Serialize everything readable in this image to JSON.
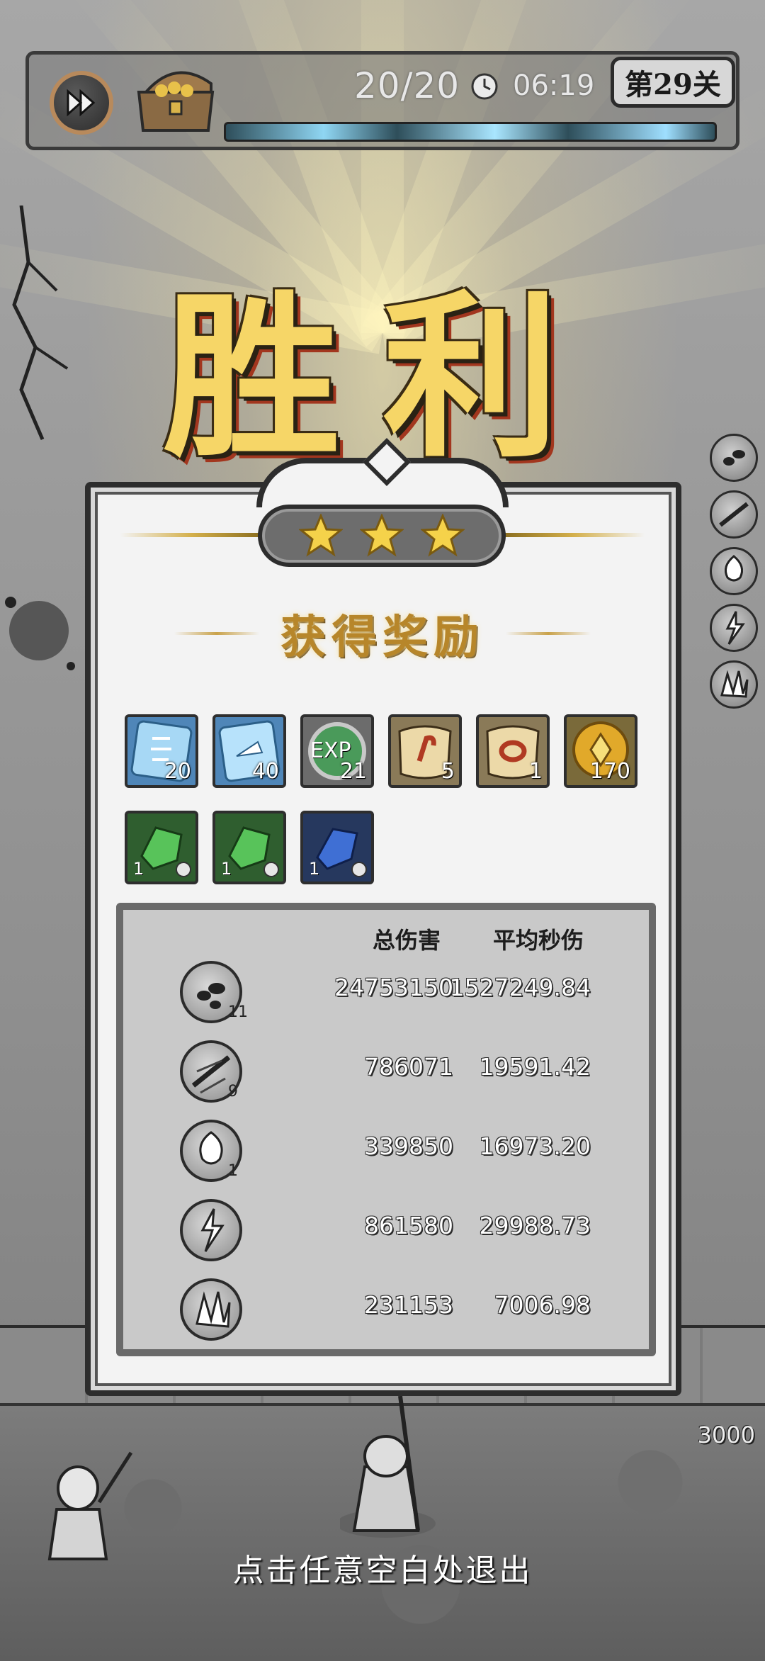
{
  "hud": {
    "wave": "20/20",
    "timer": "06:19",
    "level": "第29关",
    "speed_icon": "fast-forward-icon",
    "chest_icon": "treasure-chest-icon",
    "clock_icon": "clock-icon"
  },
  "result": {
    "title": "胜利",
    "stars_earned": 3,
    "stars_total": 3
  },
  "rewards": {
    "title": "获得奖励",
    "items": [
      {
        "icon": "blue-scroll-gem-icon",
        "count": "20"
      },
      {
        "icon": "blue-card-gem-icon",
        "count": "40"
      },
      {
        "icon": "exp-orb-icon",
        "count": "21",
        "label": "EXP"
      },
      {
        "icon": "scroll-hook-icon",
        "count": "5"
      },
      {
        "icon": "scroll-ring-icon",
        "count": "1"
      },
      {
        "icon": "gold-coin-icon",
        "count": "170"
      },
      {
        "icon": "green-crystal-icon",
        "count": "1"
      },
      {
        "icon": "green-crystal-icon",
        "count": "1"
      },
      {
        "icon": "blue-crystal-icon",
        "count": "1"
      }
    ]
  },
  "stats": {
    "header_total": "总伤害",
    "header_dps": "平均秒伤",
    "rows": [
      {
        "icon": "ink-drops-skill-icon",
        "level": "11",
        "total": "24753150",
        "dps": "1527249.84"
      },
      {
        "icon": "dash-strike-skill-icon",
        "level": "9",
        "total": "786071",
        "dps": "19591.42"
      },
      {
        "icon": "splash-skill-icon",
        "level": "1",
        "total": "339850",
        "dps": "16973.20"
      },
      {
        "icon": "lightning-skill-icon",
        "level": "",
        "total": "861580",
        "dps": "29988.73"
      },
      {
        "icon": "crystal-burst-skill-icon",
        "level": "",
        "total": "231153",
        "dps": "7006.98"
      }
    ]
  },
  "side_skills": [
    {
      "icon": "ink-drops-skill-icon",
      "level": "11"
    },
    {
      "icon": "dash-strike-skill-icon",
      "level": "9"
    },
    {
      "icon": "splash-skill-icon",
      "level": "1"
    },
    {
      "icon": "lightning-skill-icon",
      "level": ""
    },
    {
      "icon": "crystal-burst-skill-icon",
      "level": ""
    }
  ],
  "base_hp": "3000",
  "exit_hint": "点击任意空白处退出",
  "colors": {
    "gold_text": "#f6d667",
    "gold_shadow": "#a2361e",
    "panel_bg": "#f3f3f3",
    "stats_bg": "#c9c9c9",
    "lightning": "#8fd6f3"
  }
}
